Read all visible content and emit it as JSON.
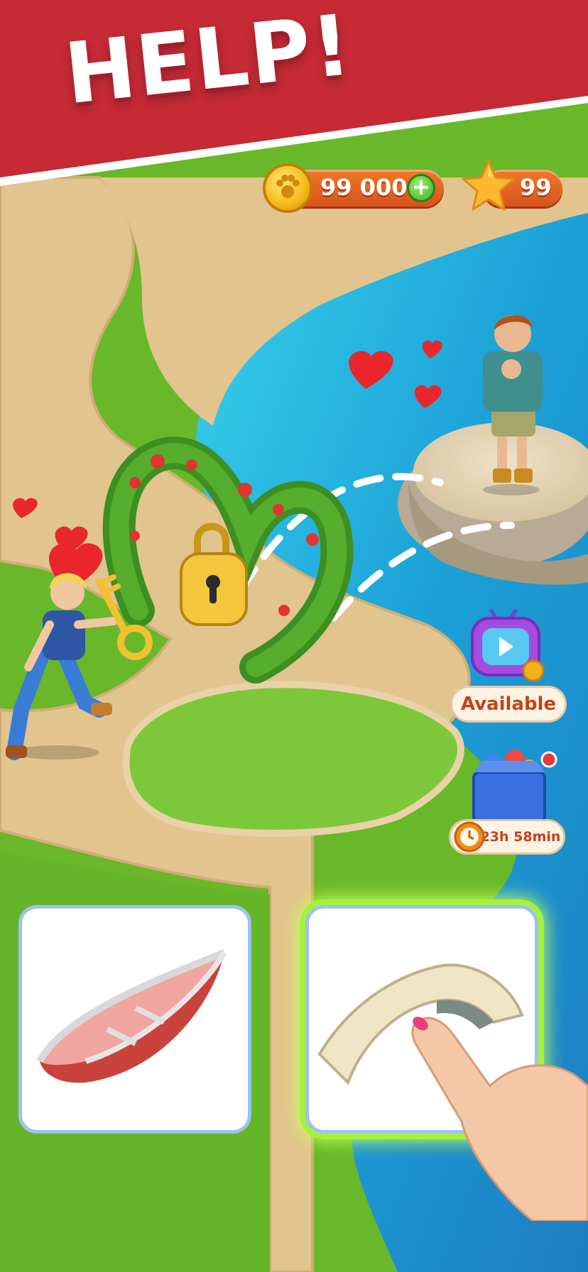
{
  "banner": {
    "title": "HELP!",
    "color": "#c52a35"
  },
  "hud": {
    "coins": {
      "value": "99 000",
      "icon": "paw-coin-icon",
      "add_icon": "plus-icon"
    },
    "stars": {
      "value": "99",
      "icon": "star-icon"
    }
  },
  "side_buttons": {
    "video_offer": {
      "label": "Available",
      "icon": "tv-video-icon"
    },
    "gift_offer": {
      "timer": "23h 58min",
      "icon": "gift-box-icon",
      "timer_icon": "alarm-clock-icon"
    }
  },
  "choices": [
    {
      "item": "boat",
      "icon": "boat-icon",
      "highlighted": false
    },
    {
      "item": "bridge",
      "icon": "bridge-icon",
      "highlighted": true
    }
  ],
  "colors": {
    "grass": "#6fbf2c",
    "sand": "#e2c48f",
    "water": "#2aa6d8",
    "highlight": "#a6f23b"
  }
}
